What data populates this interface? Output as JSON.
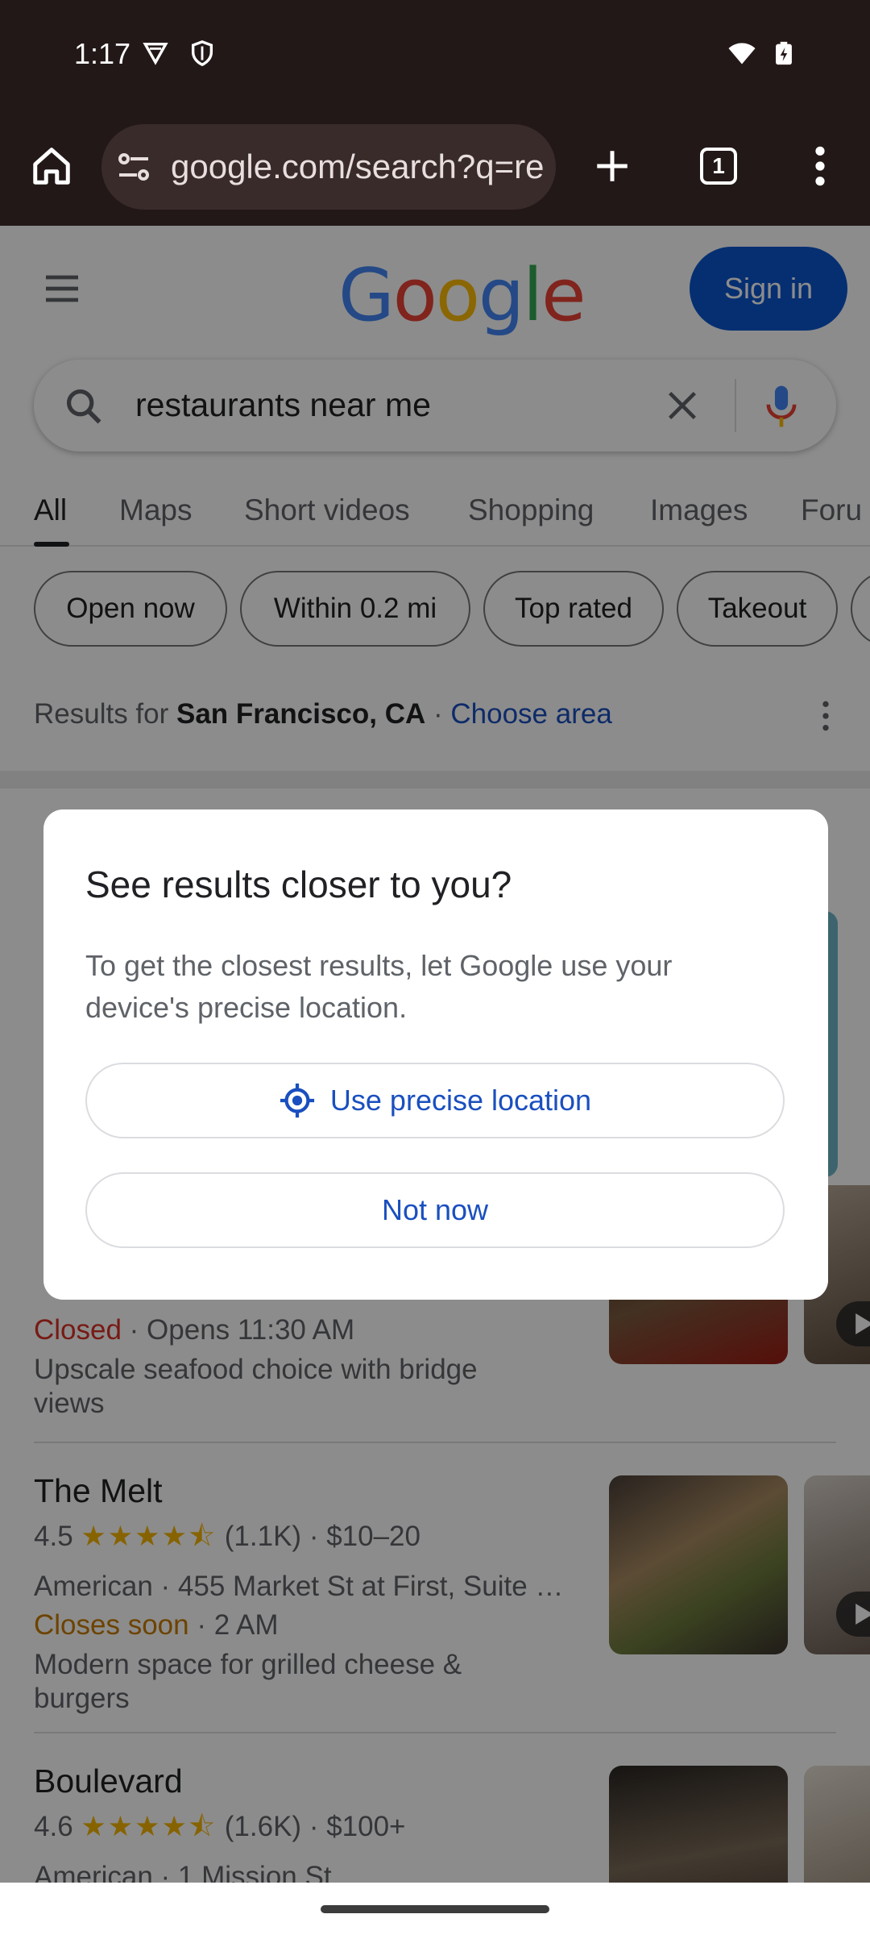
{
  "status_bar": {
    "time": "1:17"
  },
  "browser": {
    "url": "google.com/search?q=re",
    "tab_count": "1"
  },
  "header": {
    "sign_in_label": "Sign in"
  },
  "search": {
    "query": "restaurants near me"
  },
  "tabs": [
    {
      "label": "All"
    },
    {
      "label": "Maps"
    },
    {
      "label": "Short videos"
    },
    {
      "label": "Shopping"
    },
    {
      "label": "Images"
    },
    {
      "label": "Foru"
    }
  ],
  "chips": [
    {
      "label": "Open now"
    },
    {
      "label": "Within 0.2 mi"
    },
    {
      "label": "Top rated"
    },
    {
      "label": "Takeout"
    }
  ],
  "location": {
    "prefix": "Results for ",
    "city": "San Francisco, CA",
    "sep": " · ",
    "link": "Choose area"
  },
  "results": [
    {
      "status": "Closed",
      "hours": " · Opens 11:30 AM",
      "desc": "Upscale seafood choice with bridge views"
    },
    {
      "name": "The Melt",
      "rating": "4.5",
      "stars": "★★★★⯪",
      "reviews_price": "(1.1K) · $10–20",
      "category_address": "American · 455 Market St at First, Suite …",
      "status": "Closes soon",
      "hours": " · 2 AM",
      "desc": "Modern space for grilled cheese & burgers"
    },
    {
      "name": "Boulevard",
      "rating": "4.6",
      "stars": "★★★★⯪",
      "reviews_price": "(1.6K) · $100+",
      "category_address": "American · 1 Mission St"
    }
  ],
  "dialog": {
    "title": "See results closer to you?",
    "body": "To get the closest results, let Google use your device's precise location.",
    "primary_label": "Use precise location",
    "secondary_label": "Not now"
  },
  "colors": {
    "accent": "#0b57d0",
    "link": "#1a4fbf",
    "closed": "#d93025",
    "closes_soon": "#c77b00",
    "star": "#f6b400"
  }
}
